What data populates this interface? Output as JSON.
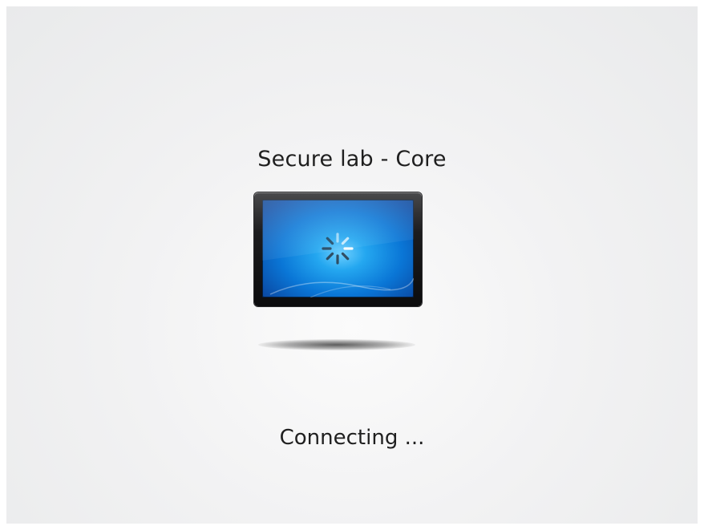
{
  "connection": {
    "title": "Secure lab - Core",
    "status": "Connecting ..."
  },
  "icons": {
    "monitor": "monitor-icon",
    "spinner": "loading-spinner-icon"
  },
  "colors": {
    "background": "#f0f0f1",
    "text": "#1f1f1f",
    "screen_accent": "#1a8fe6"
  }
}
